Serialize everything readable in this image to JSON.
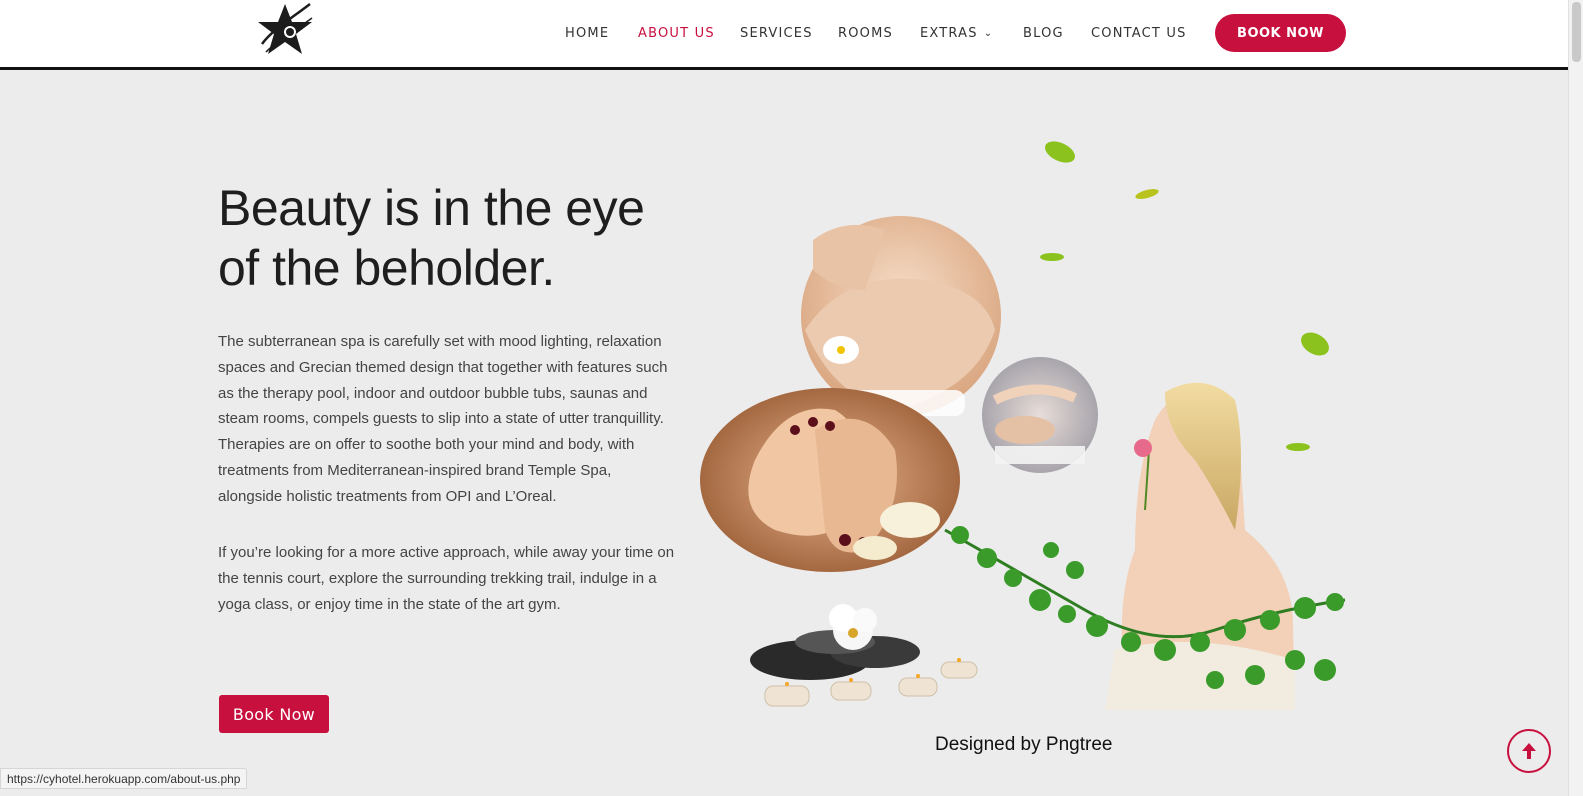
{
  "nav": {
    "items": [
      {
        "label": "HOME"
      },
      {
        "label": "ABOUT US"
      },
      {
        "label": "SERVICES"
      },
      {
        "label": "ROOMS"
      },
      {
        "label": "EXTRAS"
      },
      {
        "label": "BLOG"
      },
      {
        "label": "CONTACT US"
      }
    ],
    "book_label": "BOOK NOW",
    "active": "ABOUT US"
  },
  "main": {
    "headline_line1": "Beauty is in the eye",
    "headline_line2": "of the beholder.",
    "paragraph1": "The subterranean spa is carefully set with mood lighting, relaxation spaces and Grecian themed design that together with features such as the therapy pool, indoor and outdoor bubble tubs, saunas and steam rooms, compels guests to slip into a state of utter tranquillity. Therapies are on offer to soothe both your mind and body, with treatments from Mediterranean-inspired brand Temple Spa, alongside holistic treatments from OPI and L’Oreal.",
    "paragraph2": "If you’re looking for a more active approach, while away your time on the tennis court, explore the surrounding trekking trail, indulge in a yoga class, or enjoy time in the state of the art gym.",
    "cta_label": "Book Now",
    "image_caption": "Designed by Pngtree"
  },
  "status_url": "https://cyhotel.herokuapp.com/about-us.php",
  "colors": {
    "accent": "#c8103f",
    "background": "#ececec",
    "header": "#ffffff"
  },
  "icons": [
    "star-logo-icon",
    "chevron-down-icon",
    "arrow-up-icon"
  ]
}
